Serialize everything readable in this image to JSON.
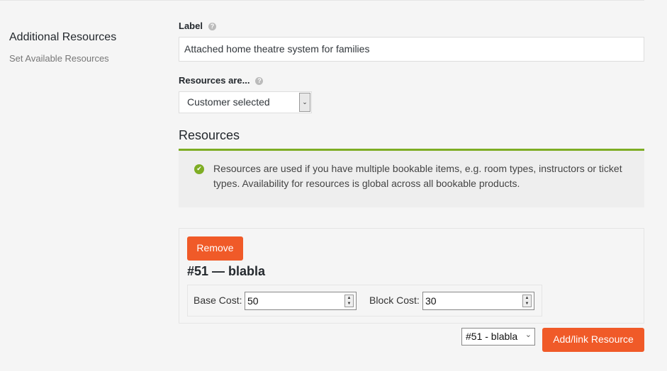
{
  "section": {
    "title": "Additional Resources",
    "subtitle": "Set Available Resources"
  },
  "label_field": {
    "label": "Label",
    "help_icon": "help-icon",
    "value": "Attached home theatre system for families"
  },
  "resources_are_field": {
    "label": "Resources are...",
    "help_icon": "help-icon",
    "selected": "Customer selected"
  },
  "resources": {
    "heading": "Resources",
    "accent_color": "#7ead24",
    "notice_icon": "check-circle-icon",
    "notice": "Resources are used if you have multiple bookable items, e.g. room types, instructors or ticket types. Availability for resources is global across all bookable products."
  },
  "resource_item": {
    "remove_label": "Remove",
    "title": "#51 — blabla",
    "base_cost_label": "Base Cost:",
    "base_cost_value": "50",
    "block_cost_label": "Block Cost:",
    "block_cost_value": "30"
  },
  "add_resource": {
    "selected": "#51 - blabla",
    "button_label": "Add/link Resource",
    "button_color": "#f05a28"
  }
}
